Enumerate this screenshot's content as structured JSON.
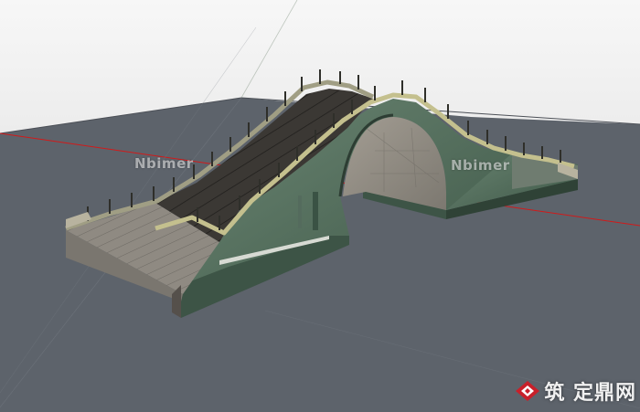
{
  "watermarks": {
    "left": "Nbimer",
    "right": "Nbimer"
  },
  "site_logo": {
    "text": "筑 定鼎网",
    "icon": "diamond-logo-icon",
    "accent": "#c8202a"
  },
  "colors": {
    "sky": "#f7f7f7",
    "ground": "#5d636b",
    "stone_deck": "#3a3632",
    "arch_green": "#4f6a5a",
    "red_axis": "#d11a1a"
  }
}
